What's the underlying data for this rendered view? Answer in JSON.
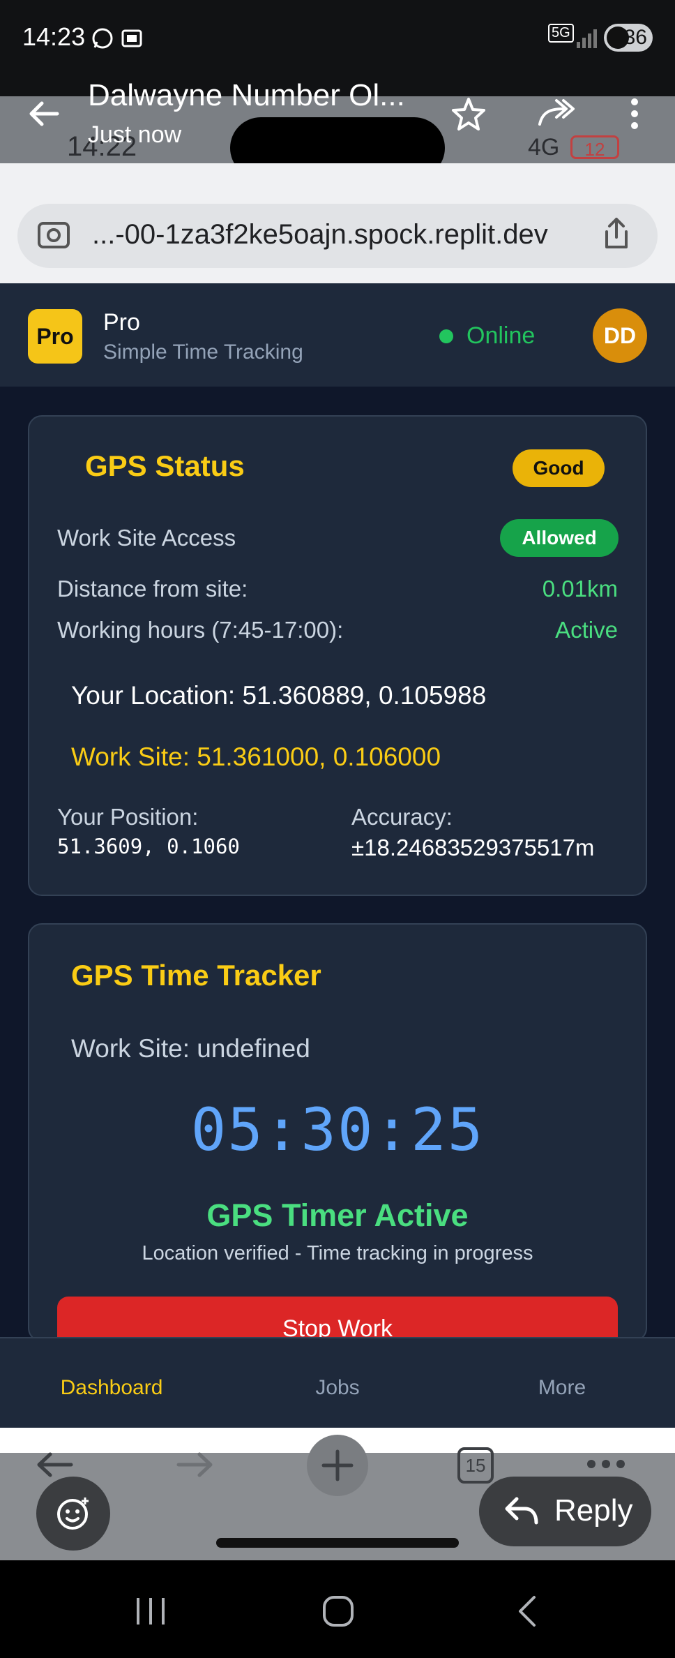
{
  "status_bar": {
    "time": "14:23",
    "battery": "36",
    "network": "5G"
  },
  "notification": {
    "title": "Dalwayne Number Ol...",
    "subtitle": "Just now",
    "reply_label": "Reply"
  },
  "underlay_status": {
    "time": "14:22",
    "network": "4G",
    "battery": "12"
  },
  "browser": {
    "url": "...-00-1za3f2ke5oajn.spock.replit.dev",
    "tab_count": "15"
  },
  "app": {
    "logo_text": "Pro",
    "brand": "Pro",
    "tagline": "Simple Time Tracking",
    "online": "Online",
    "avatar": "DD"
  },
  "gps_status": {
    "title": "GPS Status",
    "quality_badge": "Good",
    "access_label": "Work Site Access",
    "access_badge": "Allowed",
    "distance_label": "Distance from site:",
    "distance_value": "0.01km",
    "hours_label": "Working hours (7:45-17:00):",
    "hours_value": "Active",
    "your_location": "Your Location: 51.360889, 0.105988",
    "work_site": "Work Site: 51.361000, 0.106000",
    "position_label": "Your Position:",
    "position_value": "51.3609, 0.1060",
    "accuracy_label": "Accuracy:",
    "accuracy_value": "±18.24683529375517m"
  },
  "tracker": {
    "title": "GPS Time Tracker",
    "work_site": "Work Site: undefined",
    "timer": "05:30:25",
    "status": "GPS Timer Active",
    "status_sub": "Location verified - Time tracking in progress",
    "stop_button": "Stop Work"
  },
  "bottom_nav": {
    "dashboard": "Dashboard",
    "jobs": "Jobs",
    "more": "More"
  },
  "colors": {
    "accent": "#facc15",
    "success": "#22c55e",
    "danger": "#dc2626",
    "timer": "#60a5fa",
    "background": "#0f172a",
    "card": "#1e293b"
  }
}
